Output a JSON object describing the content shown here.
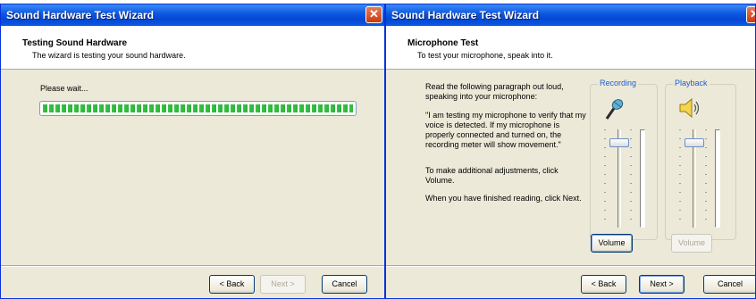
{
  "windows": [
    {
      "title": "Sound Hardware Test Wizard",
      "header": {
        "title": "Testing Sound Hardware",
        "subtitle": "The wizard is testing your sound hardware."
      },
      "status_text": "Please wait...",
      "progress_percent": 100,
      "buttons": {
        "back": "< Back",
        "next": "Next >",
        "cancel": "Cancel"
      }
    },
    {
      "title": "Sound Hardware Test Wizard",
      "header": {
        "title": "Microphone Test",
        "subtitle": "To test your microphone, speak into it."
      },
      "instructions": [
        "Read the following paragraph out loud, speaking into your microphone:",
        "\"I am testing my microphone to verify that my voice is detected. If my microphone is properly connected and turned on, the recording meter will show movement.\"",
        "To make additional adjustments, click Volume.",
        "When you have finished reading, click Next."
      ],
      "recording": {
        "label": "Recording",
        "icon": "microphone-icon",
        "button": "Volume",
        "level": 0.9
      },
      "playback": {
        "label": "Playback",
        "icon": "speaker-icon",
        "button": "Volume",
        "level": 0.9
      },
      "buttons": {
        "back": "< Back",
        "next": "Next >",
        "cancel": "Cancel"
      }
    }
  ],
  "colors": {
    "titlebar": "#0a56e0",
    "progress": "#2cb13a",
    "group_label": "#1c5ed4",
    "window_bg": "#ece9d8"
  }
}
